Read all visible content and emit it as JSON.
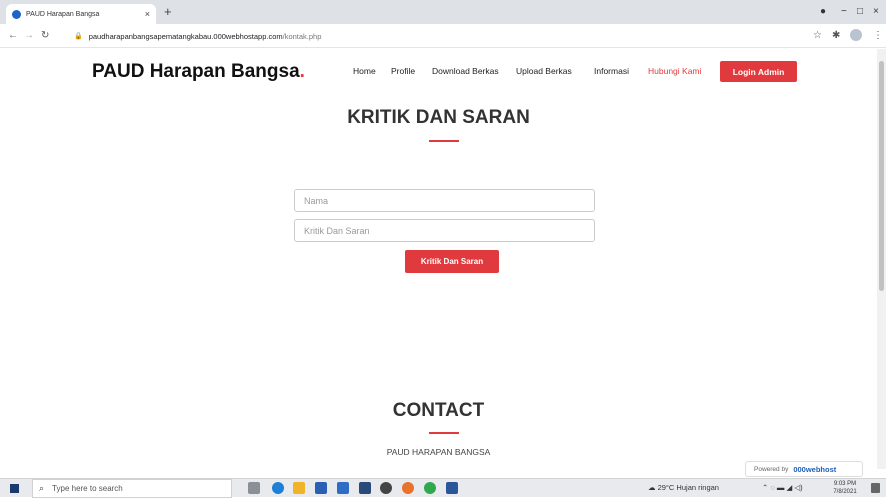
{
  "browser": {
    "tab_title": "PAUD Harapan Bangsa",
    "tab_close": "×",
    "new_tab": "+",
    "url_domain": "paudharapanbangsapematangkabau.000webhostapp.com",
    "url_path": "/kontak.php",
    "win_minimize": "−",
    "win_maximize": "□",
    "win_close": "×"
  },
  "site": {
    "brand": "PAUD Harapan Bangsa",
    "brand_dot": ".",
    "nav": [
      "Home",
      "Profile",
      "Download Berkas",
      "Upload Berkas",
      "Informasi",
      "Hubungi Kami"
    ],
    "active_nav": "Hubungi Kami",
    "login_label": "Login Admin"
  },
  "form": {
    "title": "KRITIK DAN SARAN",
    "name_placeholder": "Nama",
    "message_placeholder": "Kritik Dan Saran",
    "submit_label": "Kritik Dan Saran"
  },
  "contact": {
    "title": "CONTACT",
    "subtitle": "PAUD HARAPAN BANGSA"
  },
  "badge": {
    "powered_by": "Powered by",
    "host": "000webhost"
  },
  "taskbar": {
    "search_placeholder": "Type here to search",
    "weather": "29°C  Hujan ringan",
    "time": "9:03 PM",
    "date": "7/8/2021"
  },
  "colors": {
    "accent": "#e03a3e"
  }
}
